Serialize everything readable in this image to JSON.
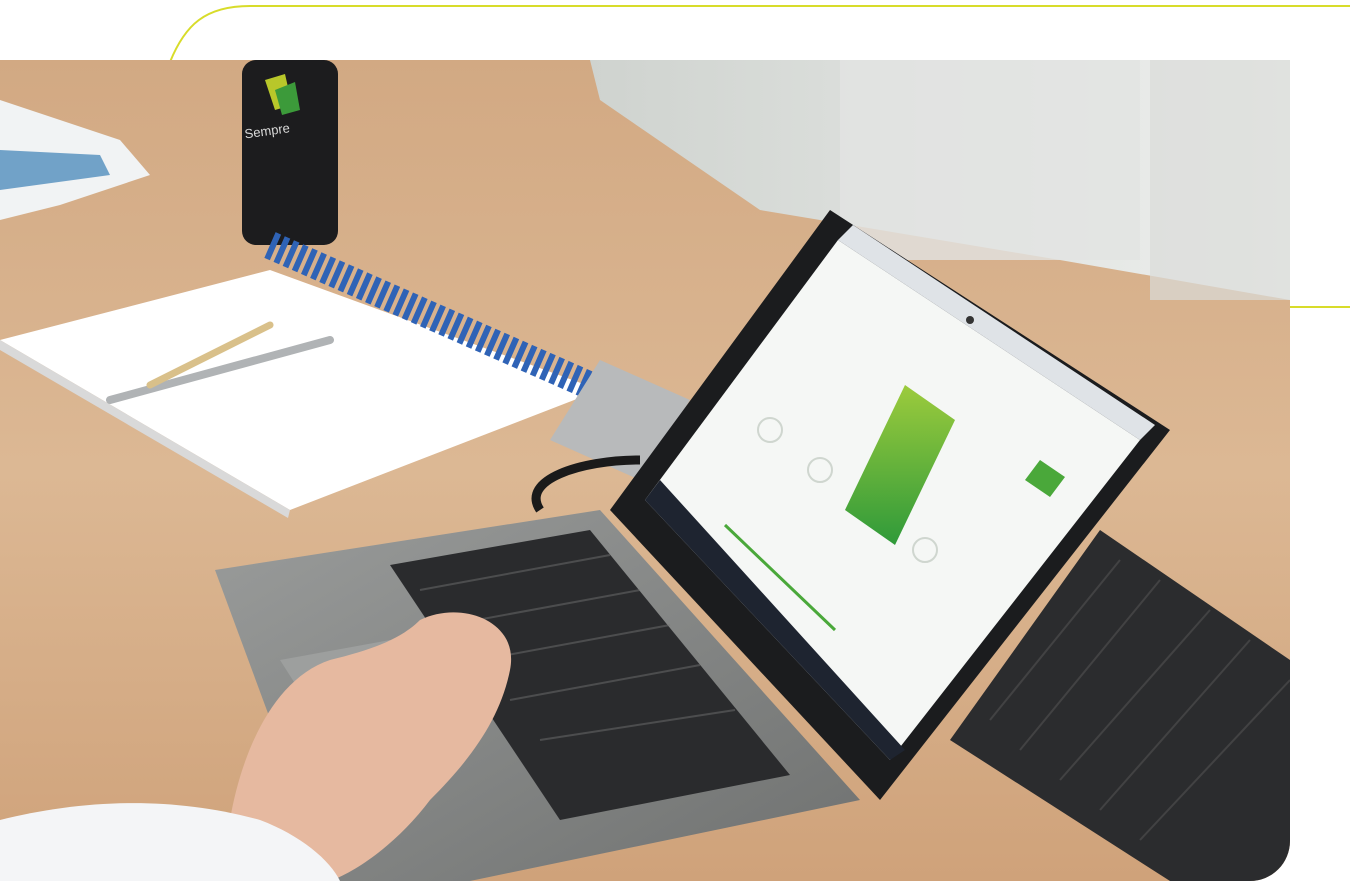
{
  "photo": {
    "description_label": "",
    "bottle_brand": "Sempre",
    "screen_heading": ""
  },
  "colors": {
    "accent": "#d8dc2a",
    "desk": "#d9b48e",
    "wall": "#e6e7e5",
    "laptop": "#8d8f8e",
    "keys": "#2a2b2d",
    "screen_green": "#4aa83a",
    "binding": "#2f63b6"
  }
}
